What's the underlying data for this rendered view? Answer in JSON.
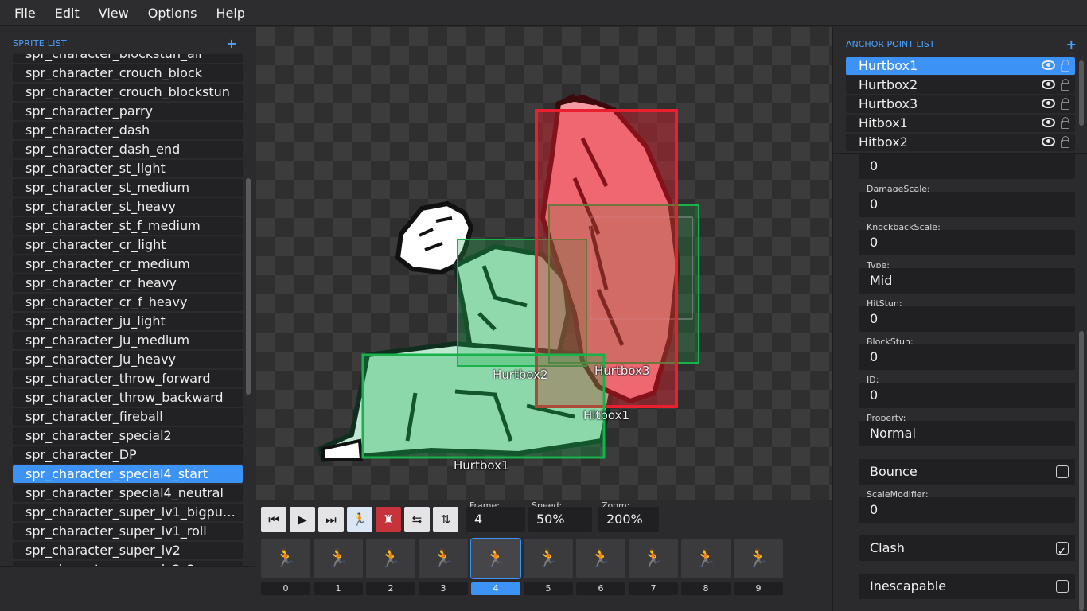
{
  "menu": [
    "File",
    "Edit",
    "View",
    "Options",
    "Help"
  ],
  "sprite_list": {
    "header": "SPRITE LIST",
    "add_label": "+",
    "items": [
      "spr_character_crouch_block",
      "spr_character_crouch_blockstun",
      "spr_character_parry",
      "spr_character_dash",
      "spr_character_dash_end",
      "spr_character_st_light",
      "spr_character_st_medium",
      "spr_character_st_heavy",
      "spr_character_st_f_medium",
      "spr_character_cr_light",
      "spr_character_cr_medium",
      "spr_character_cr_heavy",
      "spr_character_cr_f_heavy",
      "spr_character_ju_light",
      "spr_character_ju_medium",
      "spr_character_ju_heavy",
      "spr_character_throw_forward",
      "spr_character_throw_backward",
      "spr_character_fireball",
      "spr_character_special2",
      "spr_character_DP",
      "spr_character_special4_start",
      "spr_character_special4_neutral",
      "spr_character_super_lv1_bigpunc...",
      "spr_character_super_lv1_roll",
      "spr_character_super_lv2"
    ],
    "selected": "spr_character_special4_start"
  },
  "canvas": {
    "box_labels": [
      "Hurtbox2",
      "Hurtbox3",
      "Hitbox1",
      "Hurtbox1"
    ],
    "colors": {
      "hurtbox": "#17b34a",
      "hitbox": "#e8202f"
    }
  },
  "controls": {
    "frame_label": "Frame:",
    "frame_value": "4",
    "speed_label": "Speed:",
    "speed_value": "50%",
    "zoom_label": "Zoom:",
    "zoom_value": "200%",
    "buttons": [
      "prev-frame-icon",
      "play-icon",
      "next-frame-icon",
      "onion-skin-icon",
      "show-boxes-icon",
      "flip-horizontal-icon",
      "flip-vertical-icon"
    ]
  },
  "frames": {
    "numbers": [
      "0",
      "1",
      "2",
      "3",
      "4",
      "5",
      "6",
      "7",
      "8",
      "9"
    ],
    "selected": 4
  },
  "anchor_list": {
    "header": "ANCHOR POINT LIST",
    "add_label": "+",
    "items": [
      "Hurtbox1",
      "Hurtbox2",
      "Hurtbox3",
      "Hitbox1",
      "Hitbox2"
    ],
    "selected": "Hurtbox1"
  },
  "properties": {
    "top_value": "0",
    "damage_scale_label": "DamageScale:",
    "damage_scale": "0",
    "knockback_scale_label": "KnockbackScale:",
    "knockback_scale": "0",
    "type_label": "Type:",
    "type": "Mid",
    "hitstun_label": "HitStun:",
    "hitstun": "0",
    "blockstun_label": "BlockStun:",
    "blockstun": "0",
    "id_label": "ID:",
    "id": "0",
    "property_label": "Property:",
    "property": "Normal",
    "bounce_label": "Bounce",
    "bounce": false,
    "scale_modifier_label": "ScaleModifier:",
    "scale_modifier": "0",
    "clash_label": "Clash",
    "clash": true,
    "inescapable_label": "Inescapable",
    "inescapable": false
  }
}
